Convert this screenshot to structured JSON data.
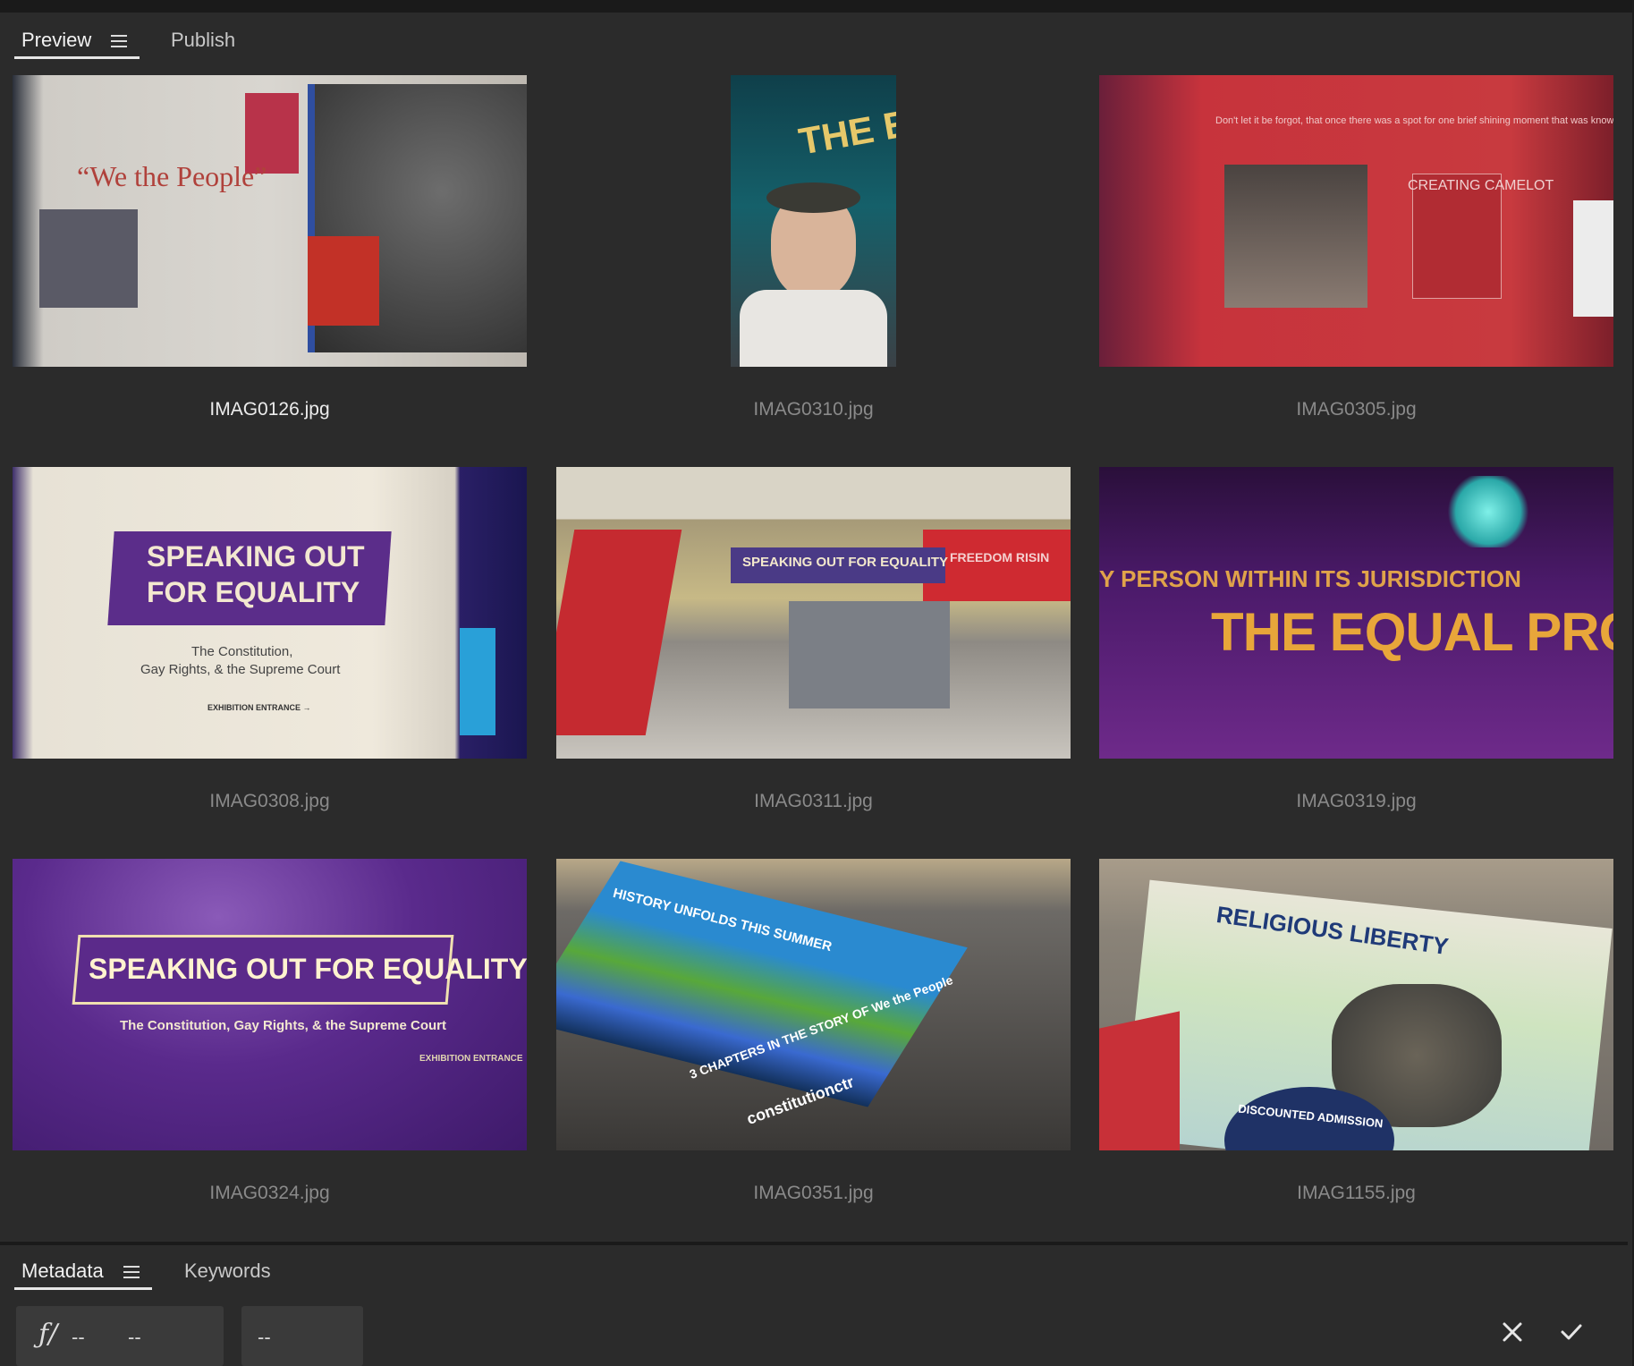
{
  "tabs_top": [
    {
      "label": "Preview",
      "active": true,
      "has_menu": true
    },
    {
      "label": "Publish",
      "active": false,
      "has_menu": false
    }
  ],
  "photos": [
    {
      "filename": "IMAG0126.jpg",
      "selected": true,
      "orientation": "landscape"
    },
    {
      "filename": "IMAG0310.jpg",
      "selected": false,
      "orientation": "portrait"
    },
    {
      "filename": "IMAG0305.jpg",
      "selected": false,
      "orientation": "landscape"
    },
    {
      "filename": "IMAG0308.jpg",
      "selected": false,
      "orientation": "landscape"
    },
    {
      "filename": "IMAG0311.jpg",
      "selected": false,
      "orientation": "landscape"
    },
    {
      "filename": "IMAG0319.jpg",
      "selected": false,
      "orientation": "landscape"
    },
    {
      "filename": "IMAG0324.jpg",
      "selected": false,
      "orientation": "landscape"
    },
    {
      "filename": "IMAG0351.jpg",
      "selected": false,
      "orientation": "landscape"
    },
    {
      "filename": "IMAG1155.jpg",
      "selected": false,
      "orientation": "landscape"
    }
  ],
  "thumb_text": {
    "we_the_people": "“We the People”",
    "speaking": "SPEAKING OUT",
    "for_equality": "FOR EQUALITY",
    "constitution_line1": "The Constitution,",
    "constitution_line2": "Gay Rights, & the Supreme Court",
    "exhibition_entrance": "EXHIBITION ENTRANCE →",
    "speaking_full": "SPEAKING OUT FOR EQUALITY",
    "constitution_full": "The Constitution, Gay Rights, & the Supreme Court",
    "freedom": "FREEDOM RISIN",
    "equal_protec": "THE EQUAL PROTEC",
    "person_jurisdiction": "Y PERSON WITHIN ITS JURISDICTION",
    "history": "HISTORY UNFOLDS THIS SUMMER",
    "three_chapters": "3 CHAPTERS IN THE STORY OF We the People",
    "constitutionctr": "constitutionctr",
    "religious": "RELIGIOUS LIBERTY",
    "discounted": "DISCOUNTED ADMISSION",
    "creating_camelot": "CREATING CAMELOT",
    "camelot_quote": "Don't let it be forgot, that once there was a spot for one brief shining moment that was known as Camelot",
    "equal": "THE EQUAL"
  },
  "tabs_bottom": [
    {
      "label": "Metadata",
      "active": true,
      "has_menu": true
    },
    {
      "label": "Keywords",
      "active": false,
      "has_menu": false
    }
  ],
  "metadata": {
    "aperture_value": "--",
    "shutter_value": "--",
    "iso_value": "--"
  },
  "icons": {
    "menu": "hamburger-icon",
    "aperture": "aperture-f-icon",
    "cancel": "close-icon",
    "confirm": "checkmark-icon"
  },
  "colors": {
    "background": "#2b2b2b",
    "text_active": "#f2f2f2",
    "text_muted": "#8a8a8a"
  }
}
